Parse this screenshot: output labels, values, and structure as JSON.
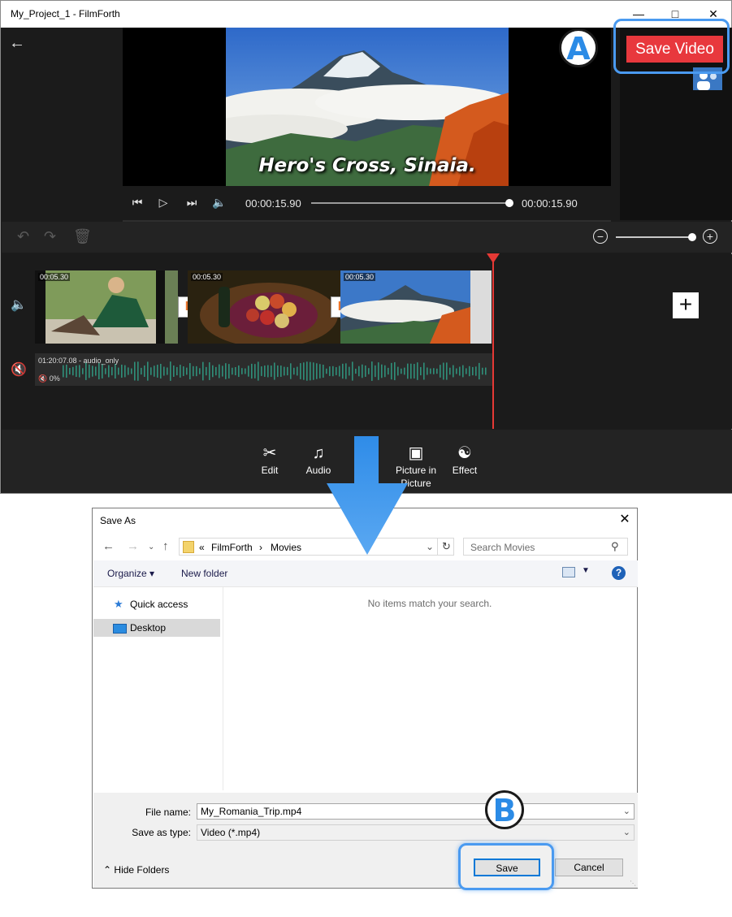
{
  "app": {
    "window_title": "My_Project_1 - FilmForth",
    "save_video_label": "Save Video",
    "preview_caption": "Hero's Cross, Sinaia.",
    "current_time": "00:00:15.90",
    "total_time": "00:00:15.90",
    "seek_progress": 1.0,
    "zoom_level": 1.0
  },
  "timeline": {
    "clips": [
      {
        "duration": "00:05.30"
      },
      {
        "duration": "00:05.30"
      },
      {
        "duration": "00:05.30"
      }
    ],
    "transition_label": "I",
    "audio": {
      "label": "01:20:07.08  - audio_only",
      "volume": "0%"
    },
    "add_icon": "+"
  },
  "tools": [
    {
      "icon": "scissors-icon",
      "label": "Edit"
    },
    {
      "icon": "music-note-icon",
      "label": "Audio"
    },
    {
      "icon": "picture-icon",
      "label": "Picture in Picture"
    },
    {
      "icon": "effect-icon",
      "label": "Effect"
    }
  ],
  "annotations": {
    "a": "A",
    "b": "B"
  },
  "dialog": {
    "title": "Save As",
    "breadcrumb": [
      "«",
      "FilmForth",
      "›",
      "Movies"
    ],
    "search_placeholder": "Search Movies",
    "organize_label": "Organize ▾",
    "new_folder_label": "New folder",
    "nav_items": [
      {
        "label": "Quick access",
        "icon": "star-icon"
      },
      {
        "label": "Desktop",
        "icon": "desktop-icon",
        "selected": true
      }
    ],
    "empty_message": "No items match your search.",
    "file_name_label": "File name:",
    "file_name_value": "My_Romania_Trip.mp4",
    "save_type_label": "Save as type:",
    "save_type_value": "Video (*.mp4)",
    "save_label": "Save",
    "cancel_label": "Cancel",
    "hide_folders_label": "Hide Folders"
  },
  "colors": {
    "accent_red": "#e8383d",
    "highlight_blue": "#4a9af0",
    "playhead": "#e53935",
    "dark_bg": "#1b1b1b"
  }
}
